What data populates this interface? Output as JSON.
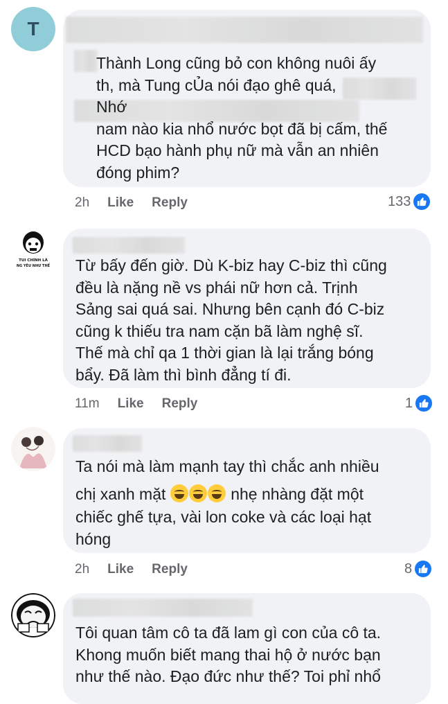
{
  "comments": [
    {
      "avatar_letter": "T",
      "text": "Thành Long cũng bỏ con không nuôi ấy\nth, mà Tung cỦa nói đạo ghê quá,\n                                    Nhớ\nnam nào kia nhổ nước bọt đã bị cấm, thế\nHCD bạo hành phụ nữ mà vẫn an nhiên\nđóng phim?",
      "time": "2h",
      "like": "Like",
      "reply": "Reply",
      "reaction_count": "133"
    },
    {
      "avatar_caption_1": "TUI CHÍNH LÀ",
      "avatar_caption_2": "NG YÊU NHƯ THẾ",
      "text": "Từ bấy đến giờ. Dù K-biz hay  C-biz thì cũng\nđều là nặng nề vs phái nữ hơn cả. Trịnh\nSảng sai quá sai. Nhưng bên cạnh đó C-biz\ncũng k thiếu tra nam cặn bã làm nghệ sĩ.\nThế mà chỉ qa 1 thời gian là lại trắng bóng\nbẩy. Đã làm thì bình đẳng tí đi.",
      "time": "11m",
      "like": "Like",
      "reply": "Reply",
      "reaction_count": "1"
    },
    {
      "text_line1": "Ta nói mà làm mạnh tay thì chắc anh nhiều",
      "text_line2a": "chị xanh mặt",
      "text_line2b": " nhẹ nhàng đặt một",
      "text_rest": "chiếc ghế tựa, vài lon coke và các loại hạt\nhóng",
      "time": "2h",
      "like": "Like",
      "reply": "Reply",
      "reaction_count": "8"
    },
    {
      "text": "Tôi quan tâm cô ta đã lam gì con của cô ta.\nKhong muốn biết mang thai hộ ở nước bạn\nnhư thế nào. Đạo đức như thế? Toi phỉ nhổ"
    }
  ],
  "colors": {
    "bubble": "#f0f2f5",
    "meta": "#65676b",
    "like_blue": "#1877f2",
    "avatar_teal": "#90cdd8"
  },
  "icons": [
    "like-thumb-icon",
    "rofl-emoji-icon"
  ]
}
